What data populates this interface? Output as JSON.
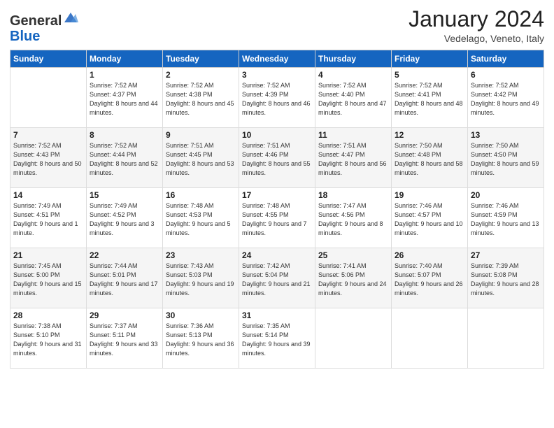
{
  "header": {
    "logo_general": "General",
    "logo_blue": "Blue",
    "month_title": "January 2024",
    "location": "Vedelago, Veneto, Italy"
  },
  "days_of_week": [
    "Sunday",
    "Monday",
    "Tuesday",
    "Wednesday",
    "Thursday",
    "Friday",
    "Saturday"
  ],
  "weeks": [
    [
      {
        "day": "",
        "sunrise": "",
        "sunset": "",
        "daylight": ""
      },
      {
        "day": "1",
        "sunrise": "Sunrise: 7:52 AM",
        "sunset": "Sunset: 4:37 PM",
        "daylight": "Daylight: 8 hours and 44 minutes."
      },
      {
        "day": "2",
        "sunrise": "Sunrise: 7:52 AM",
        "sunset": "Sunset: 4:38 PM",
        "daylight": "Daylight: 8 hours and 45 minutes."
      },
      {
        "day": "3",
        "sunrise": "Sunrise: 7:52 AM",
        "sunset": "Sunset: 4:39 PM",
        "daylight": "Daylight: 8 hours and 46 minutes."
      },
      {
        "day": "4",
        "sunrise": "Sunrise: 7:52 AM",
        "sunset": "Sunset: 4:40 PM",
        "daylight": "Daylight: 8 hours and 47 minutes."
      },
      {
        "day": "5",
        "sunrise": "Sunrise: 7:52 AM",
        "sunset": "Sunset: 4:41 PM",
        "daylight": "Daylight: 8 hours and 48 minutes."
      },
      {
        "day": "6",
        "sunrise": "Sunrise: 7:52 AM",
        "sunset": "Sunset: 4:42 PM",
        "daylight": "Daylight: 8 hours and 49 minutes."
      }
    ],
    [
      {
        "day": "7",
        "sunrise": "Sunrise: 7:52 AM",
        "sunset": "Sunset: 4:43 PM",
        "daylight": "Daylight: 8 hours and 50 minutes."
      },
      {
        "day": "8",
        "sunrise": "Sunrise: 7:52 AM",
        "sunset": "Sunset: 4:44 PM",
        "daylight": "Daylight: 8 hours and 52 minutes."
      },
      {
        "day": "9",
        "sunrise": "Sunrise: 7:51 AM",
        "sunset": "Sunset: 4:45 PM",
        "daylight": "Daylight: 8 hours and 53 minutes."
      },
      {
        "day": "10",
        "sunrise": "Sunrise: 7:51 AM",
        "sunset": "Sunset: 4:46 PM",
        "daylight": "Daylight: 8 hours and 55 minutes."
      },
      {
        "day": "11",
        "sunrise": "Sunrise: 7:51 AM",
        "sunset": "Sunset: 4:47 PM",
        "daylight": "Daylight: 8 hours and 56 minutes."
      },
      {
        "day": "12",
        "sunrise": "Sunrise: 7:50 AM",
        "sunset": "Sunset: 4:48 PM",
        "daylight": "Daylight: 8 hours and 58 minutes."
      },
      {
        "day": "13",
        "sunrise": "Sunrise: 7:50 AM",
        "sunset": "Sunset: 4:50 PM",
        "daylight": "Daylight: 8 hours and 59 minutes."
      }
    ],
    [
      {
        "day": "14",
        "sunrise": "Sunrise: 7:49 AM",
        "sunset": "Sunset: 4:51 PM",
        "daylight": "Daylight: 9 hours and 1 minute."
      },
      {
        "day": "15",
        "sunrise": "Sunrise: 7:49 AM",
        "sunset": "Sunset: 4:52 PM",
        "daylight": "Daylight: 9 hours and 3 minutes."
      },
      {
        "day": "16",
        "sunrise": "Sunrise: 7:48 AM",
        "sunset": "Sunset: 4:53 PM",
        "daylight": "Daylight: 9 hours and 5 minutes."
      },
      {
        "day": "17",
        "sunrise": "Sunrise: 7:48 AM",
        "sunset": "Sunset: 4:55 PM",
        "daylight": "Daylight: 9 hours and 7 minutes."
      },
      {
        "day": "18",
        "sunrise": "Sunrise: 7:47 AM",
        "sunset": "Sunset: 4:56 PM",
        "daylight": "Daylight: 9 hours and 8 minutes."
      },
      {
        "day": "19",
        "sunrise": "Sunrise: 7:46 AM",
        "sunset": "Sunset: 4:57 PM",
        "daylight": "Daylight: 9 hours and 10 minutes."
      },
      {
        "day": "20",
        "sunrise": "Sunrise: 7:46 AM",
        "sunset": "Sunset: 4:59 PM",
        "daylight": "Daylight: 9 hours and 13 minutes."
      }
    ],
    [
      {
        "day": "21",
        "sunrise": "Sunrise: 7:45 AM",
        "sunset": "Sunset: 5:00 PM",
        "daylight": "Daylight: 9 hours and 15 minutes."
      },
      {
        "day": "22",
        "sunrise": "Sunrise: 7:44 AM",
        "sunset": "Sunset: 5:01 PM",
        "daylight": "Daylight: 9 hours and 17 minutes."
      },
      {
        "day": "23",
        "sunrise": "Sunrise: 7:43 AM",
        "sunset": "Sunset: 5:03 PM",
        "daylight": "Daylight: 9 hours and 19 minutes."
      },
      {
        "day": "24",
        "sunrise": "Sunrise: 7:42 AM",
        "sunset": "Sunset: 5:04 PM",
        "daylight": "Daylight: 9 hours and 21 minutes."
      },
      {
        "day": "25",
        "sunrise": "Sunrise: 7:41 AM",
        "sunset": "Sunset: 5:06 PM",
        "daylight": "Daylight: 9 hours and 24 minutes."
      },
      {
        "day": "26",
        "sunrise": "Sunrise: 7:40 AM",
        "sunset": "Sunset: 5:07 PM",
        "daylight": "Daylight: 9 hours and 26 minutes."
      },
      {
        "day": "27",
        "sunrise": "Sunrise: 7:39 AM",
        "sunset": "Sunset: 5:08 PM",
        "daylight": "Daylight: 9 hours and 28 minutes."
      }
    ],
    [
      {
        "day": "28",
        "sunrise": "Sunrise: 7:38 AM",
        "sunset": "Sunset: 5:10 PM",
        "daylight": "Daylight: 9 hours and 31 minutes."
      },
      {
        "day": "29",
        "sunrise": "Sunrise: 7:37 AM",
        "sunset": "Sunset: 5:11 PM",
        "daylight": "Daylight: 9 hours and 33 minutes."
      },
      {
        "day": "30",
        "sunrise": "Sunrise: 7:36 AM",
        "sunset": "Sunset: 5:13 PM",
        "daylight": "Daylight: 9 hours and 36 minutes."
      },
      {
        "day": "31",
        "sunrise": "Sunrise: 7:35 AM",
        "sunset": "Sunset: 5:14 PM",
        "daylight": "Daylight: 9 hours and 39 minutes."
      },
      {
        "day": "",
        "sunrise": "",
        "sunset": "",
        "daylight": ""
      },
      {
        "day": "",
        "sunrise": "",
        "sunset": "",
        "daylight": ""
      },
      {
        "day": "",
        "sunrise": "",
        "sunset": "",
        "daylight": ""
      }
    ]
  ]
}
